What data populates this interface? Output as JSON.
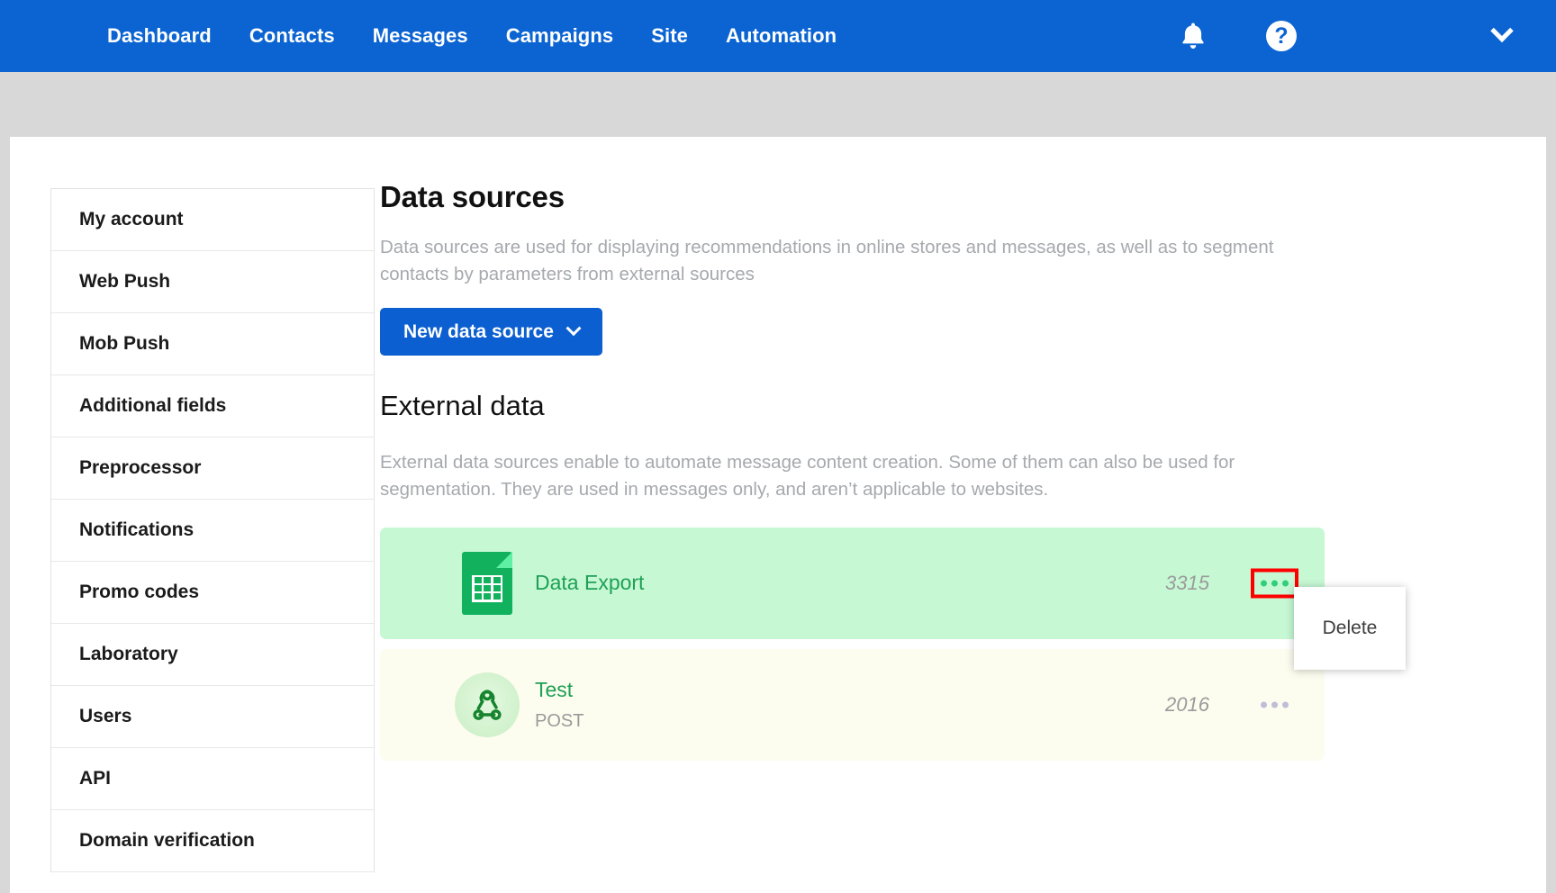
{
  "topnav": {
    "links": [
      {
        "label": "Dashboard"
      },
      {
        "label": "Contacts"
      },
      {
        "label": "Messages"
      },
      {
        "label": "Campaigns"
      },
      {
        "label": "Site"
      },
      {
        "label": "Automation"
      }
    ],
    "icons": {
      "notifications": "bell-icon",
      "help": "help-circle-icon",
      "account_menu": "chevron-down-icon"
    },
    "brand_color": "#0b64d2"
  },
  "sidebar": {
    "items": [
      {
        "label": "My account"
      },
      {
        "label": "Web Push"
      },
      {
        "label": "Mob Push"
      },
      {
        "label": "Additional fields"
      },
      {
        "label": "Preprocessor"
      },
      {
        "label": "Notifications"
      },
      {
        "label": "Promo codes"
      },
      {
        "label": "Laboratory"
      },
      {
        "label": "Users"
      },
      {
        "label": "API"
      },
      {
        "label": "Domain verification"
      }
    ]
  },
  "main": {
    "title": "Data sources",
    "description": "Data sources are used for displaying recommendations in online stores and messages, as well as to segment contacts by parameters from external sources",
    "new_button_label": "New data source",
    "section_title": "External data",
    "section_description": "External data sources enable to automate message content creation. Some of them can also be used for segmentation. They are used in messages only, and aren’t applicable to websites.",
    "rows": [
      {
        "name": "Data Export",
        "method": "",
        "count": "3315",
        "icon": "google-sheets-icon",
        "style": "green",
        "menu_highlighted": true
      },
      {
        "name": "Test",
        "method": "POST",
        "count": "2016",
        "icon": "webhook-icon",
        "style": "cream",
        "menu_highlighted": false
      }
    ]
  },
  "dropdown": {
    "items": [
      {
        "label": "Delete"
      }
    ]
  },
  "colors": {
    "accent_blue": "#0b5fd0",
    "row_green": "#c6f8d4",
    "row_cream": "#fcfcef",
    "link_green": "#1fa055",
    "highlight_red": "#fe0000"
  }
}
